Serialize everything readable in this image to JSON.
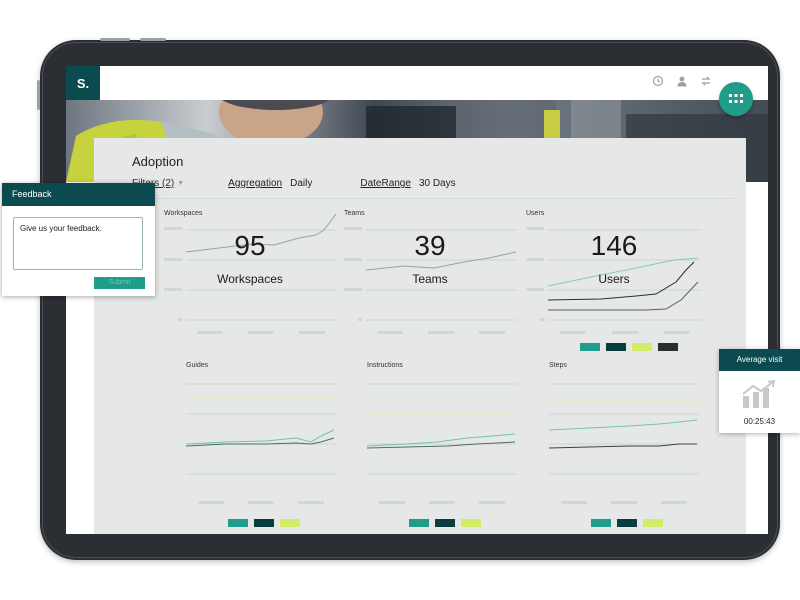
{
  "app": {
    "logo": "S."
  },
  "header": {
    "icons": [
      "clock-icon",
      "user-icon",
      "switch-icon"
    ],
    "apps_icon": "grid-icon"
  },
  "dashboard": {
    "title": "Adoption",
    "filters": "Filters (2)",
    "aggregation": {
      "label": "Aggregation",
      "value": "Daily"
    },
    "date_range": {
      "label": "DateRange",
      "value": "30 Days"
    }
  },
  "panels": [
    {
      "title": "Workspaces",
      "value": "95",
      "label": "Workspaces"
    },
    {
      "title": "Teams",
      "value": "39",
      "label": "Teams"
    },
    {
      "title": "Users",
      "value": "146",
      "label": "Users"
    },
    {
      "title": "Guides"
    },
    {
      "title": "Instructions"
    },
    {
      "title": "Steps"
    }
  ],
  "legend_colors": [
    "#1f9c8a",
    "#0b3c40",
    "#d3ec6a",
    "#2b2e30"
  ],
  "feedback": {
    "title": "Feedback",
    "placeholder": "Give us your feedback.",
    "submit": "Submit"
  },
  "average_visit": {
    "title": "Average visit",
    "value": "00:25:43"
  },
  "colors": {
    "brand": "#0b4a4f",
    "accent": "#1f9c8a",
    "lime": "#d3ec6a"
  }
}
